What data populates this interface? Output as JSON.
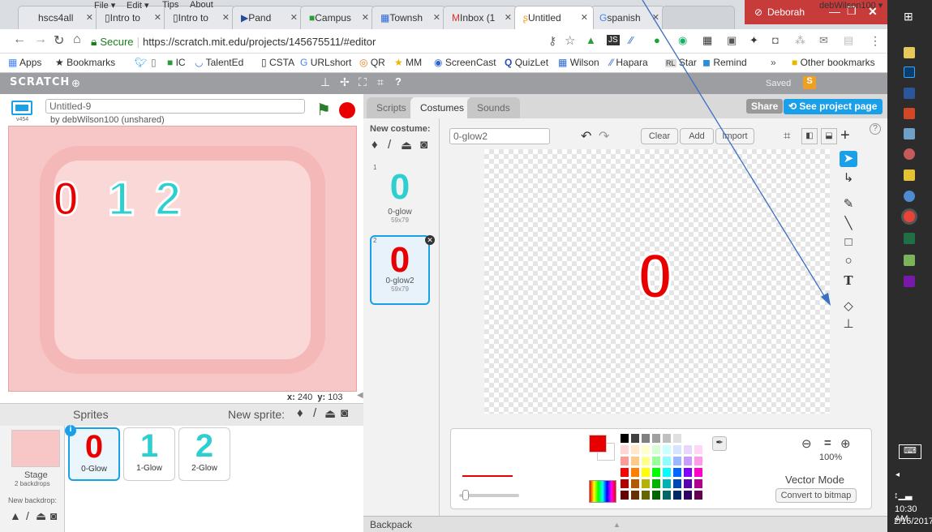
{
  "browser": {
    "tabs": [
      {
        "label": "hscs4all"
      },
      {
        "label": "Intro to"
      },
      {
        "label": "Intro to"
      },
      {
        "label": "Pand"
      },
      {
        "label": "Campus"
      },
      {
        "label": "Townsh"
      },
      {
        "label": "Inbox (1"
      },
      {
        "label": "Untitled"
      },
      {
        "label": "spanish"
      }
    ],
    "user": "Deborah",
    "secure_label": "Secure",
    "url": "https://scratch.mit.edu/projects/145675511/#editor",
    "bookmarks": [
      "Apps",
      "Bookmarks",
      "IC",
      "TalentEd",
      "CSTA",
      "URLshort",
      "QR",
      "MM",
      "ScreenCast",
      "QuizLet",
      "Wilson",
      "Hapara",
      "Star",
      "Remind"
    ],
    "other_bookmarks": "Other bookmarks",
    "bm_more": "»"
  },
  "menu": {
    "logo": "SCRATCH",
    "file": "File ▾",
    "edit": "Edit ▾",
    "tips": "Tips",
    "about": "About",
    "saved": "Saved",
    "user": "debWilson100 ▾"
  },
  "project": {
    "title": "Untitled-9",
    "byline": "by debWilson100 (unshared)",
    "version": "v454"
  },
  "stage": {
    "digits": [
      "0",
      "1",
      "2"
    ],
    "x_label": "x:",
    "x": "240",
    "y_label": "y:",
    "y": "103"
  },
  "sprites": {
    "header": "Sprites",
    "new_sprite": "New sprite:",
    "stage_label": "Stage",
    "stage_sub": "2 backdrops",
    "new_backdrop": "New backdrop:",
    "items": [
      {
        "name": "0-Glow",
        "glyph": "0"
      },
      {
        "name": "1-Glow",
        "glyph": "1"
      },
      {
        "name": "2-Glow",
        "glyph": "2"
      }
    ]
  },
  "editor": {
    "tabs": [
      "Scripts",
      "Costumes",
      "Sounds"
    ],
    "share": "Share",
    "see_page": "See project page",
    "new_costume": "New costume:",
    "costumes": [
      {
        "num": "1",
        "name": "0-glow",
        "size": "59x79",
        "glyph": "0"
      },
      {
        "num": "2",
        "name": "0-glow2",
        "size": "59x79",
        "glyph": "0"
      }
    ],
    "costume_name": "0-glow2",
    "clear": "Clear",
    "add": "Add",
    "import": "Import",
    "canvas_glyph": "0",
    "zoom": "100%",
    "mode": "Vector Mode",
    "convert": "Convert to bitmap",
    "backpack": "Backpack",
    "help": "?"
  },
  "taskbar": {
    "time": "10:30 AM",
    "date": "2/16/2017"
  },
  "colors": {
    "accent_red": "#e80000",
    "teal": "#2ecfd0",
    "scratch_blue": "#1aa0e8"
  }
}
